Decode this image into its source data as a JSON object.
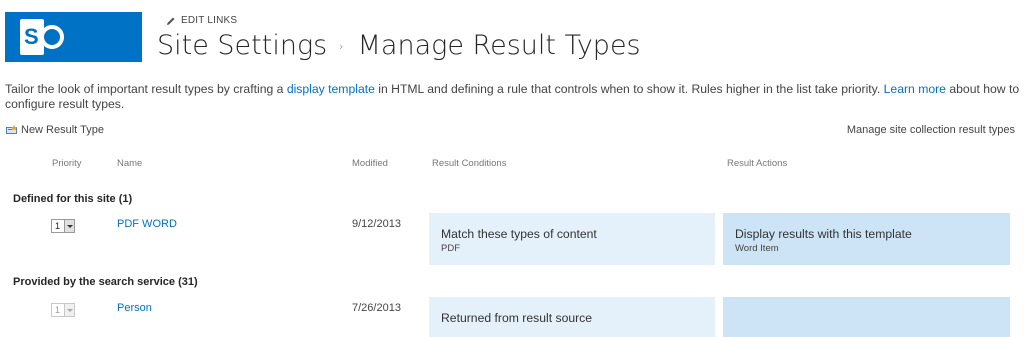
{
  "header": {
    "edit_links": "EDIT LINKS",
    "breadcrumb_parent": "Site Settings",
    "breadcrumb_separator": "›",
    "page_title": "Manage Result Types"
  },
  "description": {
    "part1": "Tailor the look of important result types by crafting a ",
    "link1": "display template",
    "part2": " in HTML and defining a rule that controls when to show it. Rules higher in the list take priority. ",
    "link2": "Learn more",
    "part3": " about how to configure result types."
  },
  "toolbar": {
    "new_result_type": "New Result Type",
    "manage_collection": "Manage site collection result types"
  },
  "columns": {
    "priority": "Priority",
    "name": "Name",
    "modified": "Modified",
    "conditions": "Result Conditions",
    "actions": "Result Actions"
  },
  "groups": [
    {
      "label": "Defined for this site (1)",
      "rows": [
        {
          "priority": "1",
          "name": "PDF WORD",
          "modified": "9/12/2013",
          "condition_title": "Match these types of content",
          "condition_detail": "PDF",
          "action_title": "Display results with this template",
          "action_detail": "Word Item"
        }
      ]
    },
    {
      "label": "Provided by the search service (31)",
      "rows": [
        {
          "priority": "1",
          "name": "Person",
          "modified": "7/26/2013",
          "condition_title": "Returned from result source",
          "condition_detail": "",
          "action_title": "",
          "action_detail": ""
        }
      ]
    }
  ],
  "colors": {
    "brand": "#0072c6",
    "link": "#0072c6",
    "condition_box": "#e4f0fa",
    "action_box": "#cce4f6"
  },
  "icons": {
    "logo": "sharepoint-logo",
    "edit": "pencil-icon",
    "new": "new-item-icon"
  }
}
